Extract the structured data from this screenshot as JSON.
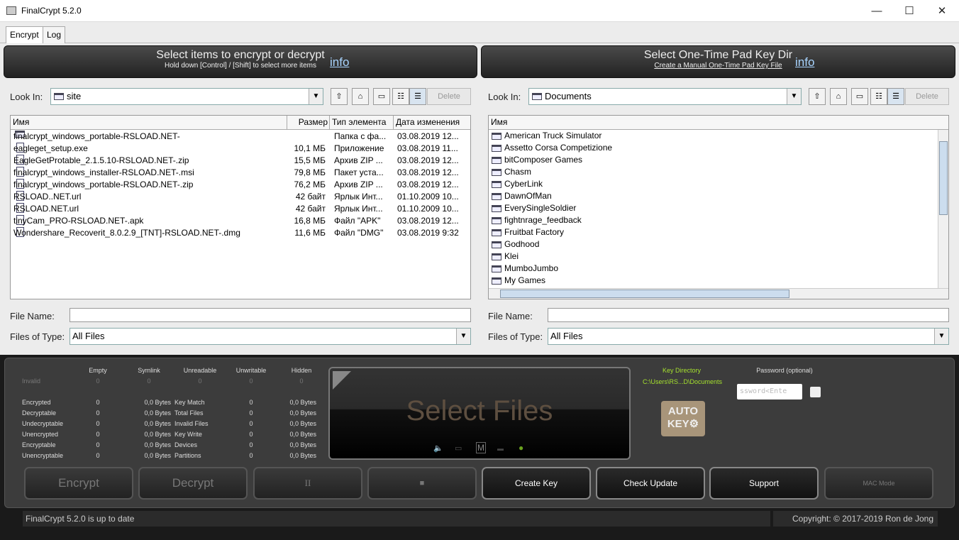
{
  "window": {
    "title": "FinalCrypt 5.2.0",
    "minimize": "—",
    "maximize": "☐",
    "close": "✕"
  },
  "tabs": [
    {
      "label": "Encrypt"
    },
    {
      "label": "Log"
    }
  ],
  "left": {
    "header": "Select items to encrypt or decrypt",
    "subheader": "Hold down [Control] / [Shift] to select more items",
    "info": "info",
    "look_in_label": "Look In:",
    "look_in": "site",
    "delete": "Delete",
    "columns": [
      "Имя",
      "Размер",
      "Тип элемента",
      "Дата изменения"
    ],
    "files": [
      {
        "name": "finalcrypt_windows_portable-RSLOAD.NET-",
        "size": "",
        "type": "Папка с фа...",
        "date": "03.08.2019 12...",
        "folder": true
      },
      {
        "name": "eagleget_setup.exe",
        "size": "10,1 МБ",
        "type": "Приложение",
        "date": "03.08.2019 11..."
      },
      {
        "name": "EagleGetProtable_2.1.5.10-RSLOAD.NET-.zip",
        "size": "15,5 МБ",
        "type": "Архив ZIP ...",
        "date": "03.08.2019 12..."
      },
      {
        "name": "finalcrypt_windows_installer-RSLOAD.NET-.msi",
        "size": "79,8 МБ",
        "type": "Пакет уста...",
        "date": "03.08.2019 12..."
      },
      {
        "name": "finalcrypt_windows_portable-RSLOAD.NET-.zip",
        "size": "76,2 МБ",
        "type": "Архив ZIP ...",
        "date": "03.08.2019 12..."
      },
      {
        "name": "RSLOAD..NET.url",
        "size": "42 байт",
        "type": "Ярлык Инт...",
        "date": "01.10.2009 10..."
      },
      {
        "name": "RSLOAD.NET.url",
        "size": "42 байт",
        "type": "Ярлык Инт...",
        "date": "01.10.2009 10..."
      },
      {
        "name": "tinyCam_PRO-RSLOAD.NET-.apk",
        "size": "16,8 МБ",
        "type": "Файл \"APK\"",
        "date": "03.08.2019 12..."
      },
      {
        "name": "Wondershare_Recoverit_8.0.2.9_[TNT]-RSLOAD.NET-.dmg",
        "size": "11,6 МБ",
        "type": "Файл \"DMG\"",
        "date": "03.08.2019 9:32"
      }
    ],
    "file_name_label": "File Name:",
    "file_name": "",
    "files_of_type_label": "Files of Type:",
    "files_of_type": "All Files"
  },
  "right": {
    "header": "Select One-Time Pad Key Dir",
    "subheader": "Create a Manual One-Time Pad Key File",
    "info": "info",
    "look_in_label": "Look In:",
    "look_in": "Documents",
    "delete": "Delete",
    "columns": [
      "Имя"
    ],
    "folders": [
      "American Truck Simulator",
      "Assetto Corsa Competizione",
      "bitComposer Games",
      "Chasm",
      "CyberLink",
      "DawnOfMan",
      "EverySingleSoldier",
      "fightnrage_feedback",
      "Fruitbat Factory",
      "Godhood",
      "Klei",
      "MumboJumbo",
      "My Games"
    ],
    "file_name_label": "File Name:",
    "file_name": "",
    "files_of_type_label": "Files of Type:",
    "files_of_type": "All Files"
  },
  "stats": {
    "top_headers": [
      "Empty",
      "Symlink",
      "Unreadable",
      "Unwritable",
      "Hidden"
    ],
    "invalid_label": "Invalid",
    "invalid_values": [
      "0",
      "0",
      "0",
      "0",
      "0"
    ],
    "rows": [
      [
        "Encrypted",
        "0",
        "0,0 Bytes",
        "Key Match",
        "0",
        "0,0 Bytes"
      ],
      [
        "Decryptable",
        "0",
        "0,0 Bytes",
        "Total Files",
        "0",
        "0,0 Bytes"
      ],
      [
        "Undecryptable",
        "0",
        "0,0 Bytes",
        "Invalid Files",
        "0",
        "0,0 Bytes"
      ],
      [
        "Unencrypted",
        "0",
        "0,0 Bytes",
        "Key Write",
        "0",
        "0,0 Bytes"
      ],
      [
        "Encryptable",
        "0",
        "0,0 Bytes",
        "Devices",
        "0",
        "0,0 Bytes"
      ],
      [
        "Unencryptable",
        "0",
        "0,0 Bytes",
        "Partitions",
        "0",
        "0,0 Bytes"
      ]
    ]
  },
  "display": {
    "text": "Select Files",
    "text_color": "#5e4f40",
    "indicator_color": "#6aa21e"
  },
  "key": {
    "label": "Key Directory",
    "path": "C:\\Users\\RS...D\\Documents",
    "color": "#a6e22e",
    "autokey_line1": "AUTO",
    "autokey_line2": "KEY⚙"
  },
  "password": {
    "label": "Password (optional)",
    "value": "ssword<Ente"
  },
  "buttons": {
    "encrypt": "Encrypt",
    "decrypt": "Decrypt",
    "pause": "II",
    "stop": "■",
    "create_key": "Create Key",
    "check_update": "Check Update",
    "support": "Support",
    "mac_mode": "MAC Mode"
  },
  "status": "FinalCrypt 5.2.0 is up to date",
  "copyright": "Copyright: © 2017-2019 Ron de Jong"
}
